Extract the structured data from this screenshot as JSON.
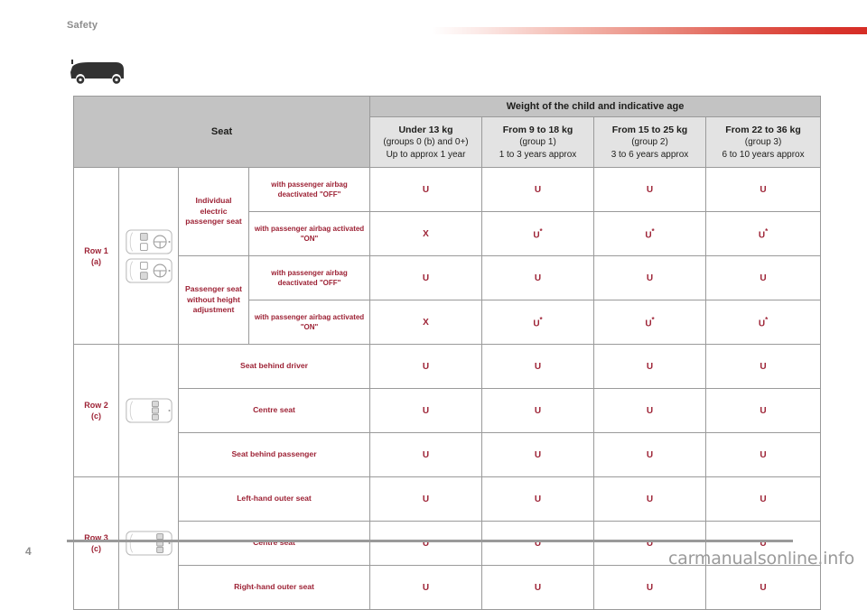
{
  "header": {
    "section_title": "Safety",
    "accent_color": "#d62d26",
    "vehicle_icon": "van-side-icon"
  },
  "table": {
    "seat_column_header": "Seat",
    "weight_header": "Weight of the child and indicative age",
    "weight_columns": [
      {
        "weight": "Under 13 kg",
        "group": "(groups 0 (b) and 0+)",
        "age": "Up to approx 1 year"
      },
      {
        "weight": "From 9 to 18 kg",
        "group": "(group 1)",
        "age": "1 to 3 years approx"
      },
      {
        "weight": "From 15 to 25 kg",
        "group": "(group 2)",
        "age": "3 to 6 years approx"
      },
      {
        "weight": "From 22 to 36 kg",
        "group": "(group 3)",
        "age": "6 to 10 years approx"
      }
    ],
    "row_groups": [
      {
        "label": "Row 1",
        "note": "(a)",
        "icon": "van-top-view-front-row-icon",
        "rows": [
          {
            "seat_type": "Individual electric passenger seat",
            "condition": "with passenger airbag deactivated \"OFF\"",
            "values": [
              "U",
              "U",
              "U",
              "U"
            ]
          },
          {
            "seat_type": "Individual electric passenger seat",
            "condition": "with passenger airbag activated \"ON\"",
            "values": [
              "X",
              "U*",
              "U*",
              "U*"
            ]
          },
          {
            "seat_type": "Passenger seat without height adjustment",
            "condition": "with passenger airbag deactivated \"OFF\"",
            "values": [
              "U",
              "U",
              "U",
              "U"
            ]
          },
          {
            "seat_type": "Passenger seat without height adjustment",
            "condition": "with passenger airbag activated \"ON\"",
            "values": [
              "X",
              "U*",
              "U*",
              "U*"
            ]
          }
        ]
      },
      {
        "label": "Row 2",
        "note": "(c)",
        "icon": "van-top-view-second-row-icon",
        "rows": [
          {
            "seat_type": "Seat behind driver",
            "condition": "",
            "values": [
              "U",
              "U",
              "U",
              "U"
            ]
          },
          {
            "seat_type": "Centre seat",
            "condition": "",
            "values": [
              "U",
              "U",
              "U",
              "U"
            ]
          },
          {
            "seat_type": "Seat behind passenger",
            "condition": "",
            "values": [
              "U",
              "U",
              "U",
              "U"
            ]
          }
        ]
      },
      {
        "label": "Row 3",
        "note": "(c)",
        "icon": "van-top-view-third-row-icon",
        "rows": [
          {
            "seat_type": "Left-hand outer seat",
            "condition": "",
            "values": [
              "U",
              "U",
              "U",
              "U"
            ]
          },
          {
            "seat_type": "Centre seat",
            "condition": "",
            "values": [
              "U",
              "U",
              "U",
              "U"
            ]
          },
          {
            "seat_type": "Right-hand outer seat",
            "condition": "",
            "values": [
              "U",
              "U",
              "U",
              "U"
            ]
          }
        ]
      }
    ]
  },
  "footer": {
    "page_number": "4",
    "watermark": "carmanualsonline.info"
  }
}
